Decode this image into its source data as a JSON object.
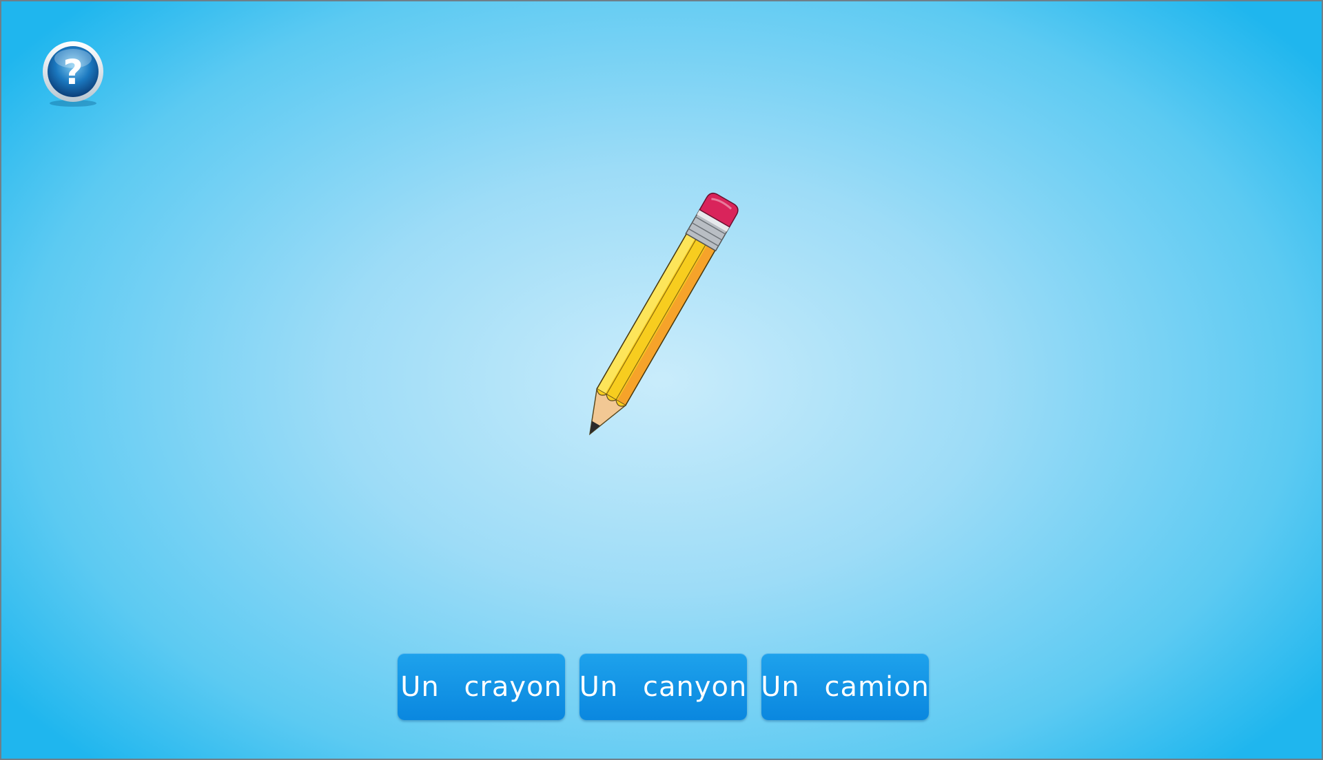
{
  "help": {
    "icon": "help-question-icon",
    "symbol": "?"
  },
  "picture": {
    "icon": "pencil-icon"
  },
  "answers": [
    {
      "label": "Un crayon"
    },
    {
      "label": "Un canyon"
    },
    {
      "label": "Un camion"
    }
  ],
  "colors": {
    "button": "#0a8fe4",
    "button_text": "#ffffff",
    "background_center": "#c9ecfb",
    "background_edge": "#1fb6ee",
    "pencil_body": "#f7cd1f",
    "eraser": "#d9245b"
  }
}
